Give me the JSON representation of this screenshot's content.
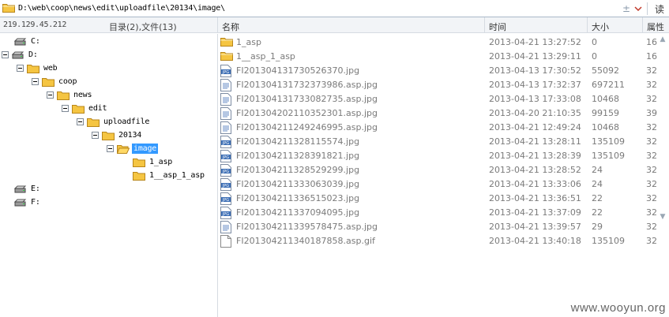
{
  "address_bar": {
    "path": "D:\\web\\coop\\news\\edit\\uploadfile\\20134\\image\\",
    "plus_minus": "±",
    "read_label": "读"
  },
  "header": {
    "ip": "219.129.45.212",
    "dir_summary": "目录(2),文件(13)",
    "columns": {
      "name": "名称",
      "time": "时间",
      "size": "大小",
      "attr": "属性"
    }
  },
  "tree": [
    {
      "label": "C:",
      "type": "drive"
    },
    {
      "label": "D:",
      "type": "drive"
    },
    {
      "label": "web",
      "type": "folder"
    },
    {
      "label": "coop",
      "type": "folder"
    },
    {
      "label": "news",
      "type": "folder"
    },
    {
      "label": "edit",
      "type": "folder"
    },
    {
      "label": "uploadfile",
      "type": "folder"
    },
    {
      "label": "20134",
      "type": "folder"
    },
    {
      "label": "image",
      "type": "folder",
      "selected": true
    },
    {
      "label": "1_asp",
      "type": "folder"
    },
    {
      "label": "1__asp_1_asp",
      "type": "folder"
    },
    {
      "label": "E:",
      "type": "drive"
    },
    {
      "label": "F:",
      "type": "drive"
    }
  ],
  "files": [
    {
      "name": "1_asp",
      "time": "2013-04-21 13:27:52",
      "size": "0",
      "attr": "16",
      "icon": "folder-icon"
    },
    {
      "name": "1__asp_1_asp",
      "time": "2013-04-21 13:29:11",
      "size": "0",
      "attr": "16",
      "icon": "folder-icon"
    },
    {
      "name": "FI20130413173052637​0.jpg",
      "time": "2013-04-13 17:30:52",
      "size": "55092",
      "attr": "32",
      "icon": "jpg-icon"
    },
    {
      "name": "FI20130413173237398​6.asp.jpg",
      "time": "2013-04-13 17:32:37",
      "size": "697211",
      "attr": "32",
      "icon": "document-icon"
    },
    {
      "name": "FI20130413173308273​5.asp.jpg",
      "time": "2013-04-13 17:33:08",
      "size": "10468",
      "attr": "32",
      "icon": "document-icon"
    },
    {
      "name": "FI20130420211035230​1.asp.jpg",
      "time": "2013-04-20 21:10:35",
      "size": "99159",
      "attr": "39",
      "icon": "document-icon"
    },
    {
      "name": "FI20130421124924699​5.asp.jpg",
      "time": "2013-04-21 12:49:24",
      "size": "10468",
      "attr": "32",
      "icon": "document-icon"
    },
    {
      "name": "FI20130421132811557​4.jpg",
      "time": "2013-04-21 13:28:11",
      "size": "135109",
      "attr": "32",
      "icon": "jpg-icon"
    },
    {
      "name": "FI20130421132839182​1.jpg",
      "time": "2013-04-21 13:28:39",
      "size": "135109",
      "attr": "32",
      "icon": "jpg-icon"
    },
    {
      "name": "FI20130421132852929​9.jpg",
      "time": "2013-04-21 13:28:52",
      "size": "24",
      "attr": "32",
      "icon": "jpg-icon"
    },
    {
      "name": "FI20130421133306303​9.jpg",
      "time": "2013-04-21 13:33:06",
      "size": "24",
      "attr": "32",
      "icon": "jpg-icon"
    },
    {
      "name": "FI20130421133651502​3.jpg",
      "time": "2013-04-21 13:36:51",
      "size": "22",
      "attr": "32",
      "icon": "jpg-icon"
    },
    {
      "name": "FI20130421133709409​5.jpg",
      "time": "2013-04-21 13:37:09",
      "size": "22",
      "attr": "32",
      "icon": "jpg-icon"
    },
    {
      "name": "FI20130421133957847​5.asp.jpg",
      "time": "2013-04-21 13:39:57",
      "size": "29",
      "attr": "32",
      "icon": "document-icon"
    },
    {
      "name": "FI20130421134018785​8.asp.gif",
      "time": "2013-04-21 13:40:18",
      "size": "135109",
      "attr": "32",
      "icon": "blank-file-icon"
    }
  ],
  "watermark": "www.wooyun.org",
  "colors": {
    "selection": "#3399ff",
    "folder": "#f5c542",
    "header_bg": "#f2f4f7"
  }
}
